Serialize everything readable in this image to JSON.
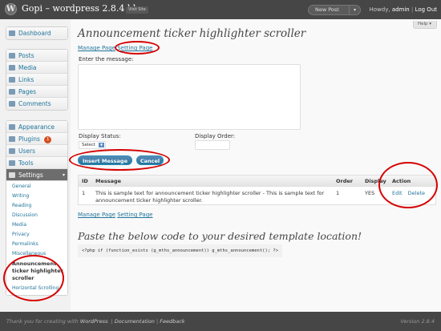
{
  "header": {
    "site_title": "Gopi – wordpress 2.8.4 blog",
    "visit_site": "Visit Site",
    "new_post": "New Post",
    "new_post_arrow": "▾",
    "howdy": "Howdy,",
    "username": "admin",
    "separator": "|",
    "logout": "Log Out",
    "logo_letter": "W"
  },
  "help": {
    "label": "Help ▾"
  },
  "sidebar": {
    "dashboard": "Dashboard",
    "group1": [
      "Posts",
      "Media",
      "Links",
      "Pages",
      "Comments"
    ],
    "appearance": "Appearance",
    "plugins": "Plugins",
    "plugins_badge": "1",
    "users": "Users",
    "tools": "Tools",
    "settings": "Settings",
    "settings_caret": "▾",
    "settings_sub": [
      "General",
      "Writing",
      "Reading",
      "Discussion",
      "Media",
      "Privacy",
      "Permalinks",
      "Miscellaneous"
    ],
    "current_sub": "Announcement ticker highlighter scroller",
    "last_sub": "Horizontal Scrolling"
  },
  "main": {
    "title": "Announcement ticker highlighter scroller",
    "manage_page": "Manage Page",
    "setting_page": "Setting Page",
    "enter_message_label": "Enter the message:",
    "message_value": "",
    "display_status_label": "Display Status:",
    "display_status_value": "Select",
    "display_order_label": "Display Order:",
    "display_order_value": "",
    "insert_button": "Insert Message",
    "cancel_button": "Cancel",
    "paste_title": "Paste the below code to your desired template location!",
    "code": "<?php if (function_exists (g_mths_announcement)) g_mths_announcement(); ?>"
  },
  "table": {
    "headers": {
      "id": "ID",
      "message": "Message",
      "order": "Order",
      "display": "Display",
      "action": "Action"
    },
    "rows": [
      {
        "id": "1",
        "message": "This is sample text for announcement ticker highlighter scroller - This is sample text for announcement ticker highlighter scroller.",
        "order": "1",
        "display": "YES",
        "edit": "Edit",
        "delete": "Delete"
      }
    ]
  },
  "footer": {
    "thank_you": "Thank you for creating with",
    "wordpress": "WordPress",
    "separator": ". |",
    "documentation": "Documentation",
    "feedback": "Feedback",
    "version": "Version 2.8.4"
  },
  "colors": {
    "header_bg": "#464646",
    "link": "#21759b",
    "button": "#21759b",
    "annotation": "#d40000"
  },
  "icons": [
    "wp-logo-icon",
    "dashboard-icon",
    "posts-icon",
    "media-icon",
    "links-icon",
    "pages-icon",
    "comments-icon",
    "appearance-icon",
    "plugins-icon",
    "users-icon",
    "tools-icon",
    "settings-icon"
  ]
}
